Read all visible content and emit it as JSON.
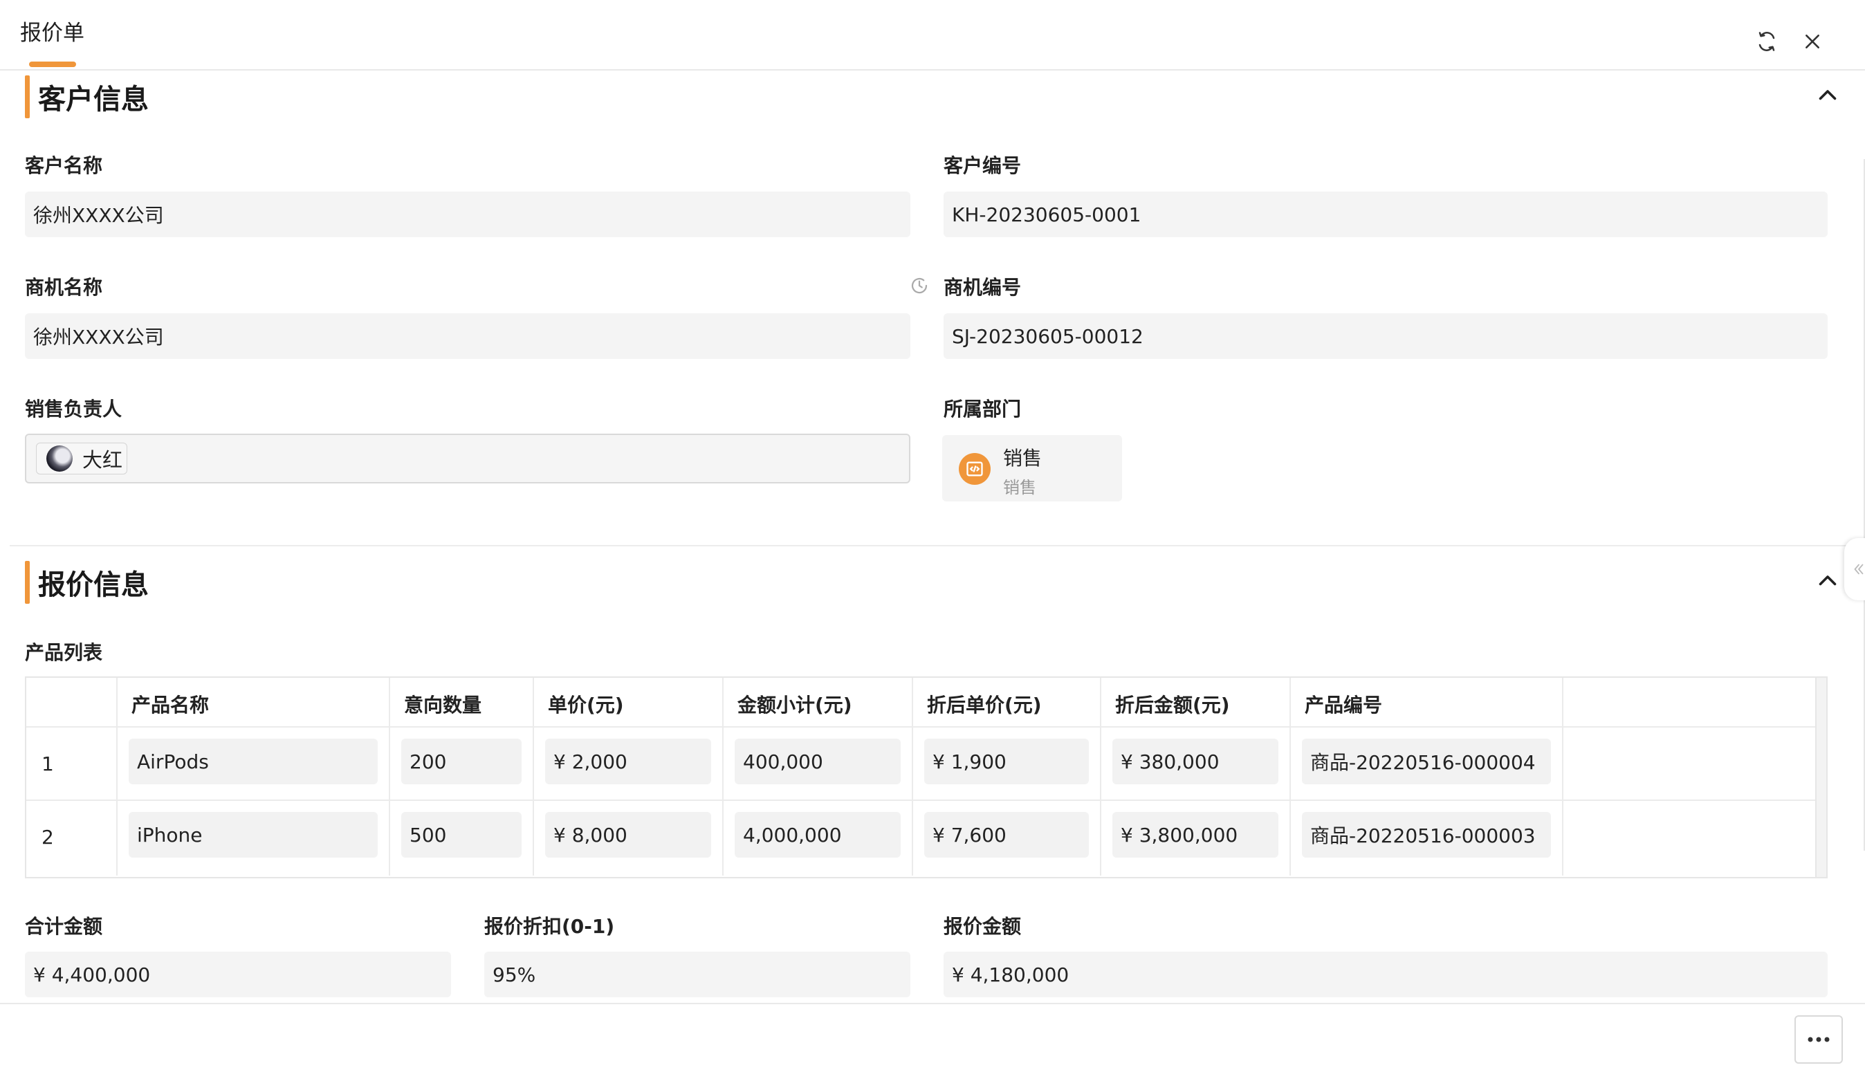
{
  "header": {
    "title": "报价单"
  },
  "customer_section": {
    "title": "客户信息",
    "fields": {
      "customer_name": {
        "label": "客户名称",
        "value": "徐州XXXX公司"
      },
      "customer_no": {
        "label": "客户编号",
        "value": "KH-20230605-0001"
      },
      "opportunity_name": {
        "label": "商机名称",
        "value": "徐州XXXX公司"
      },
      "opportunity_no": {
        "label": "商机编号",
        "value": "SJ-20230605-00012"
      },
      "sales_owner": {
        "label": "销售负责人",
        "value": "大红"
      },
      "department": {
        "label": "所属部门",
        "name": "销售",
        "sub": "销售"
      }
    }
  },
  "quote_section": {
    "title": "报价信息",
    "product_list_label": "产品列表",
    "table": {
      "columns": [
        "产品名称",
        "意向数量",
        "单价(元)",
        "金额小计(元)",
        "折后单价(元)",
        "折后金额(元)",
        "产品编号"
      ],
      "rows": [
        [
          "1",
          "AirPods",
          "200",
          "¥ 2,000",
          "400,000",
          "¥ 1,900",
          "¥ 380,000",
          "商品-20220516-000004"
        ],
        [
          "2",
          "iPhone",
          "500",
          "¥ 8,000",
          "4,000,000",
          "¥ 7,600",
          "¥ 3,800,000",
          "商品-20220516-000003"
        ]
      ]
    },
    "totals": {
      "total_amount": {
        "label": "合计金额",
        "value": "¥ 4,400,000"
      },
      "discount": {
        "label": "报价折扣(0-1)",
        "value": "95%"
      },
      "quote_amount": {
        "label": "报价金额",
        "value": "¥ 4,180,000"
      }
    }
  },
  "colors": {
    "accent": "#f0963a"
  },
  "icons": [
    "refresh-icon",
    "close-icon",
    "chevron-up-icon",
    "history-icon",
    "code-icon",
    "more-icon",
    "double-chevron-left-icon"
  ]
}
